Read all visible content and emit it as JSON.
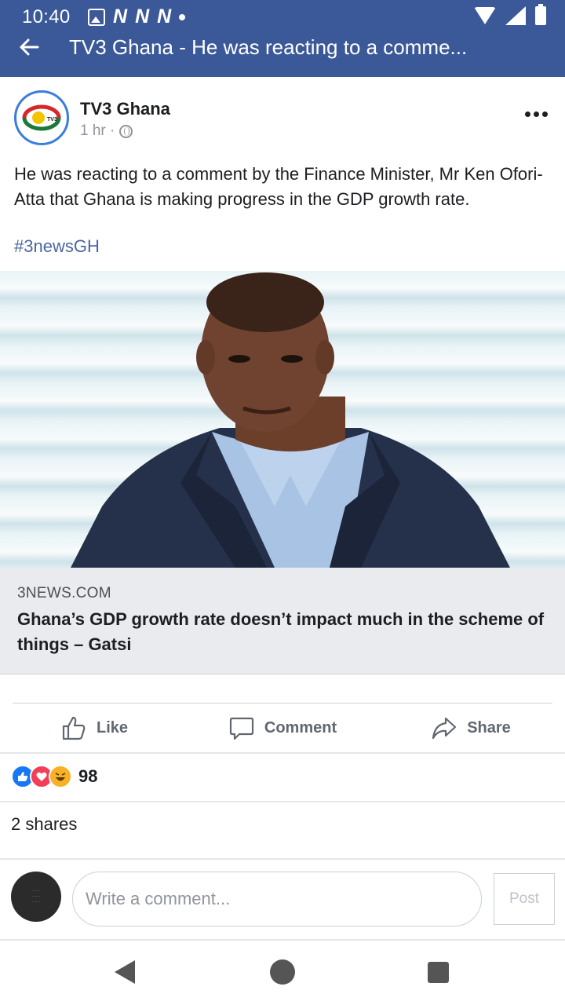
{
  "status_bar": {
    "time": "10:40",
    "notification_letters": [
      "N",
      "N",
      "N"
    ]
  },
  "app_bar": {
    "title": "TV3 Ghana - He was reacting to a comme..."
  },
  "post": {
    "page_name": "TV3 Ghana",
    "time": "1 hr ·",
    "avatar_text": "TV3",
    "text": "He was reacting to a comment by the Finance Minister, Mr Ken Ofori-Atta that Ghana is making progress in the GDP growth rate.",
    "hashtag": "#3newsGH"
  },
  "link_preview": {
    "domain": "3NEWS.COM",
    "title": "Ghana’s GDP growth rate doesn’t impact much in the scheme of things – Gatsi"
  },
  "actions": {
    "like": "Like",
    "comment": "Comment",
    "share": "Share"
  },
  "reactions": {
    "count": "98"
  },
  "shares_text": "2 shares",
  "composer": {
    "placeholder": "Write a comment...",
    "post_label": "Post"
  },
  "colors": {
    "brand_blue": "#3b5998",
    "link_blue": "#4b67a1",
    "like_blue": "#1877f2",
    "love_red": "#f33e58",
    "haha_yellow": "#f7b125"
  }
}
